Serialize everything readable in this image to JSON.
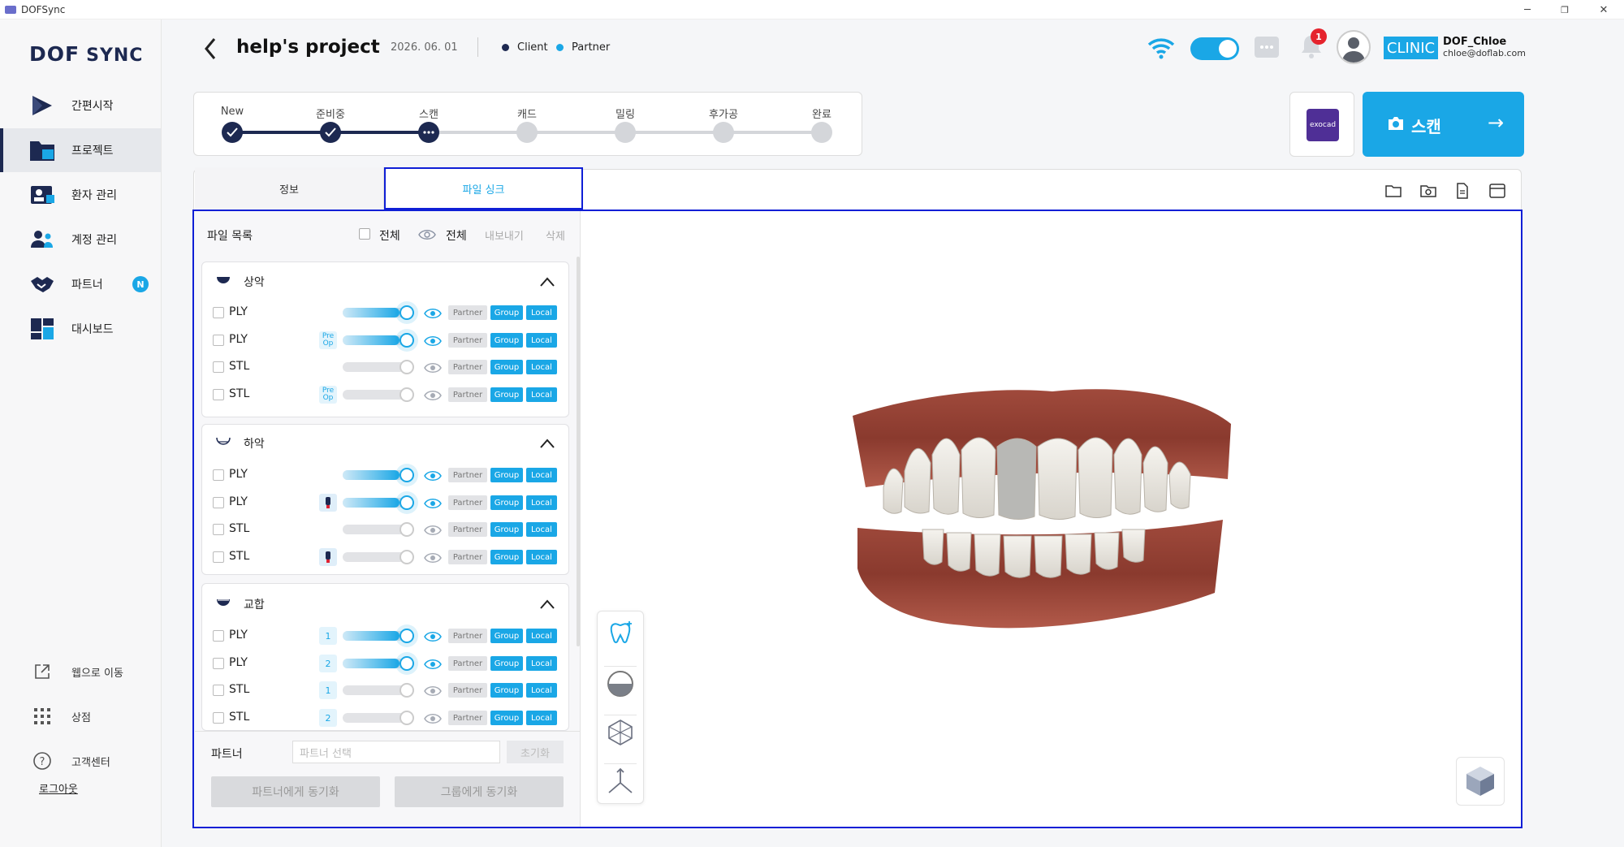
{
  "window": {
    "title": "DOFSync",
    "minimize": "─",
    "maximize": "❐",
    "close": "✕"
  },
  "sidebar": {
    "logo_dof": "DOF",
    "logo_sync": "SYNC",
    "items": [
      {
        "label": "간편시작",
        "icon": "play-icon"
      },
      {
        "label": "프로젝트",
        "icon": "folder-icon",
        "active": true
      },
      {
        "label": "환자 관리",
        "icon": "patient-icon"
      },
      {
        "label": "계정 관리",
        "icon": "users-icon"
      },
      {
        "label": "파트너",
        "icon": "handshake-icon",
        "badge": "N"
      },
      {
        "label": "대시보드",
        "icon": "dashboard-icon"
      }
    ],
    "bottom": [
      {
        "label": "웹으로 이동",
        "icon": "external-link-icon"
      },
      {
        "label": "상점",
        "icon": "grid-icon"
      },
      {
        "label": "고객센터",
        "icon": "help-icon"
      }
    ],
    "logout": "로그아웃"
  },
  "header": {
    "title": "help's project",
    "date": "2026. 06. 01",
    "legend": [
      {
        "label": "Client",
        "color": "#1d2951"
      },
      {
        "label": "Partner",
        "color": "#1aa7e6"
      }
    ],
    "notification_count": "1",
    "role": "CLINIC",
    "user_name": "DOF_Chloe",
    "user_email": "chloe@doflab.com"
  },
  "progress": {
    "steps": [
      {
        "label": "New",
        "state": "done"
      },
      {
        "label": "준비중",
        "state": "done"
      },
      {
        "label": "스캔",
        "state": "current"
      },
      {
        "label": "캐드",
        "state": "todo"
      },
      {
        "label": "밀링",
        "state": "todo"
      },
      {
        "label": "후가공",
        "state": "todo"
      },
      {
        "label": "완료",
        "state": "todo"
      }
    ]
  },
  "actions": {
    "exocad_label": "exocad",
    "scan_label": "스캔"
  },
  "tabs": {
    "info": "정보",
    "file_sync": "파일 싱크"
  },
  "file_panel": {
    "title": "파일 목록",
    "select_all": "전체",
    "show_all": "전체",
    "export": "내보내기",
    "delete": "삭제",
    "chip_partner": "Partner",
    "chip_group": "Group",
    "chip_local": "Local",
    "groups": [
      {
        "name": "상악",
        "rows": [
          {
            "type": "PLY",
            "tag": "",
            "visible": true,
            "opacity": 0.8
          },
          {
            "type": "PLY",
            "tag": "Pre Op",
            "visible": true,
            "opacity": 0.8
          },
          {
            "type": "STL",
            "tag": "",
            "visible": false,
            "opacity": 0
          },
          {
            "type": "STL",
            "tag": "Pre Op",
            "visible": false,
            "opacity": 0
          }
        ]
      },
      {
        "name": "하악",
        "rows": [
          {
            "type": "PLY",
            "tag": "",
            "visible": true,
            "opacity": 0.8
          },
          {
            "type": "PLY",
            "tag": "tooth",
            "visible": true,
            "opacity": 0.8
          },
          {
            "type": "STL",
            "tag": "",
            "visible": false,
            "opacity": 0
          },
          {
            "type": "STL",
            "tag": "tooth",
            "visible": false,
            "opacity": 0
          }
        ]
      },
      {
        "name": "교합",
        "rows": [
          {
            "type": "PLY",
            "tag": "1",
            "visible": true,
            "opacity": 0.8
          },
          {
            "type": "PLY",
            "tag": "2",
            "visible": true,
            "opacity": 0.8
          },
          {
            "type": "STL",
            "tag": "1",
            "visible": false,
            "opacity": 0
          },
          {
            "type": "STL",
            "tag": "2",
            "visible": false,
            "opacity": 0
          }
        ]
      }
    ],
    "partner_label": "파트너",
    "partner_placeholder": "파트너 선택",
    "reset": "초기화",
    "sync_partner": "파트너에게 동기화",
    "sync_group": "그룹에게 동기화"
  },
  "colors": {
    "accent": "#1aa7e6",
    "navy": "#1d2951",
    "highlight": "#0f1fd6"
  }
}
